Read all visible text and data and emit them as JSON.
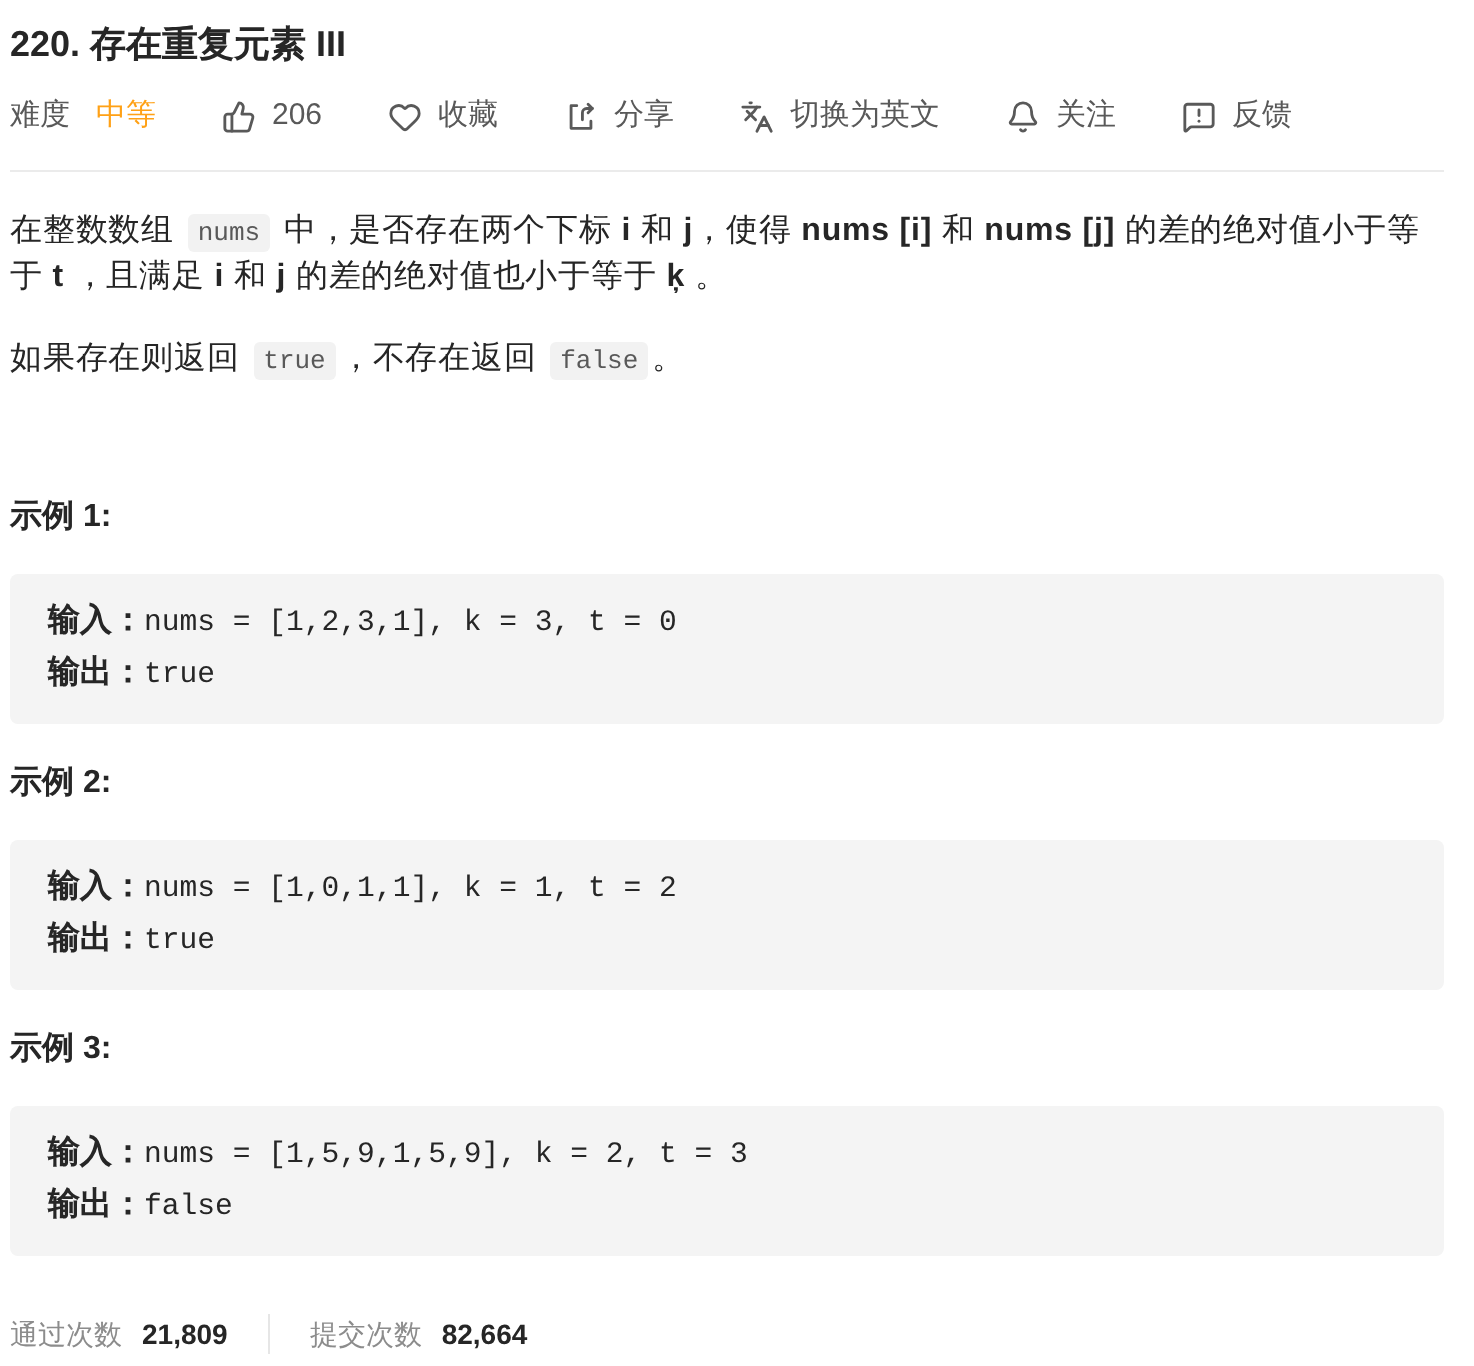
{
  "title": "220. 存在重复元素 III",
  "meta": {
    "difficulty_label": "难度",
    "difficulty": {
      "label": "中等",
      "kind": "medium"
    },
    "actions": [
      {
        "kind": "like",
        "label": "206"
      },
      {
        "kind": "favorite",
        "label": "收藏"
      },
      {
        "kind": "share",
        "label": "分享"
      },
      {
        "kind": "translate",
        "label": "切换为英文"
      },
      {
        "kind": "follow",
        "label": "关注"
      },
      {
        "kind": "feedback",
        "label": "反馈"
      }
    ]
  },
  "description": [
    [
      {
        "kind": "text",
        "text": "在整数数组 "
      },
      {
        "kind": "code",
        "text": "nums"
      },
      {
        "kind": "text",
        "text": " 中，是否存在两个下标 **i** 和 **j**，使得 **nums [i]** 和 **nums [j]** 的差的绝对值小于等于 **t** ，且满足 **i** 和 **j** 的差的绝对值也小于等于 **ķ** 。"
      }
    ],
    [
      {
        "kind": "text",
        "text": "如果存在则返回 "
      },
      {
        "kind": "code",
        "text": "true"
      },
      {
        "kind": "text",
        "text": "，不存在返回 "
      },
      {
        "kind": "code",
        "text": "false"
      },
      {
        "kind": "text",
        "text": "。"
      }
    ]
  ],
  "examples": [
    {
      "heading": "示例 1:",
      "lines": [
        "**输入：**nums = [1,2,3,1], k = 3, t = 0",
        "**输出：**true"
      ]
    },
    {
      "heading": "示例 2:",
      "lines": [
        "**输入：**nums = [1,0,1,1], k = 1, t = 2",
        "**输出：**true"
      ]
    },
    {
      "heading": "示例 3:",
      "lines": [
        "**输入：**nums = [1,5,9,1,5,9], k = 2, t = 3",
        "**输出：**false"
      ]
    }
  ],
  "stats": [
    {
      "label": "通过次数",
      "value": "21,809"
    },
    {
      "label": "提交次数",
      "value": "82,664"
    }
  ]
}
